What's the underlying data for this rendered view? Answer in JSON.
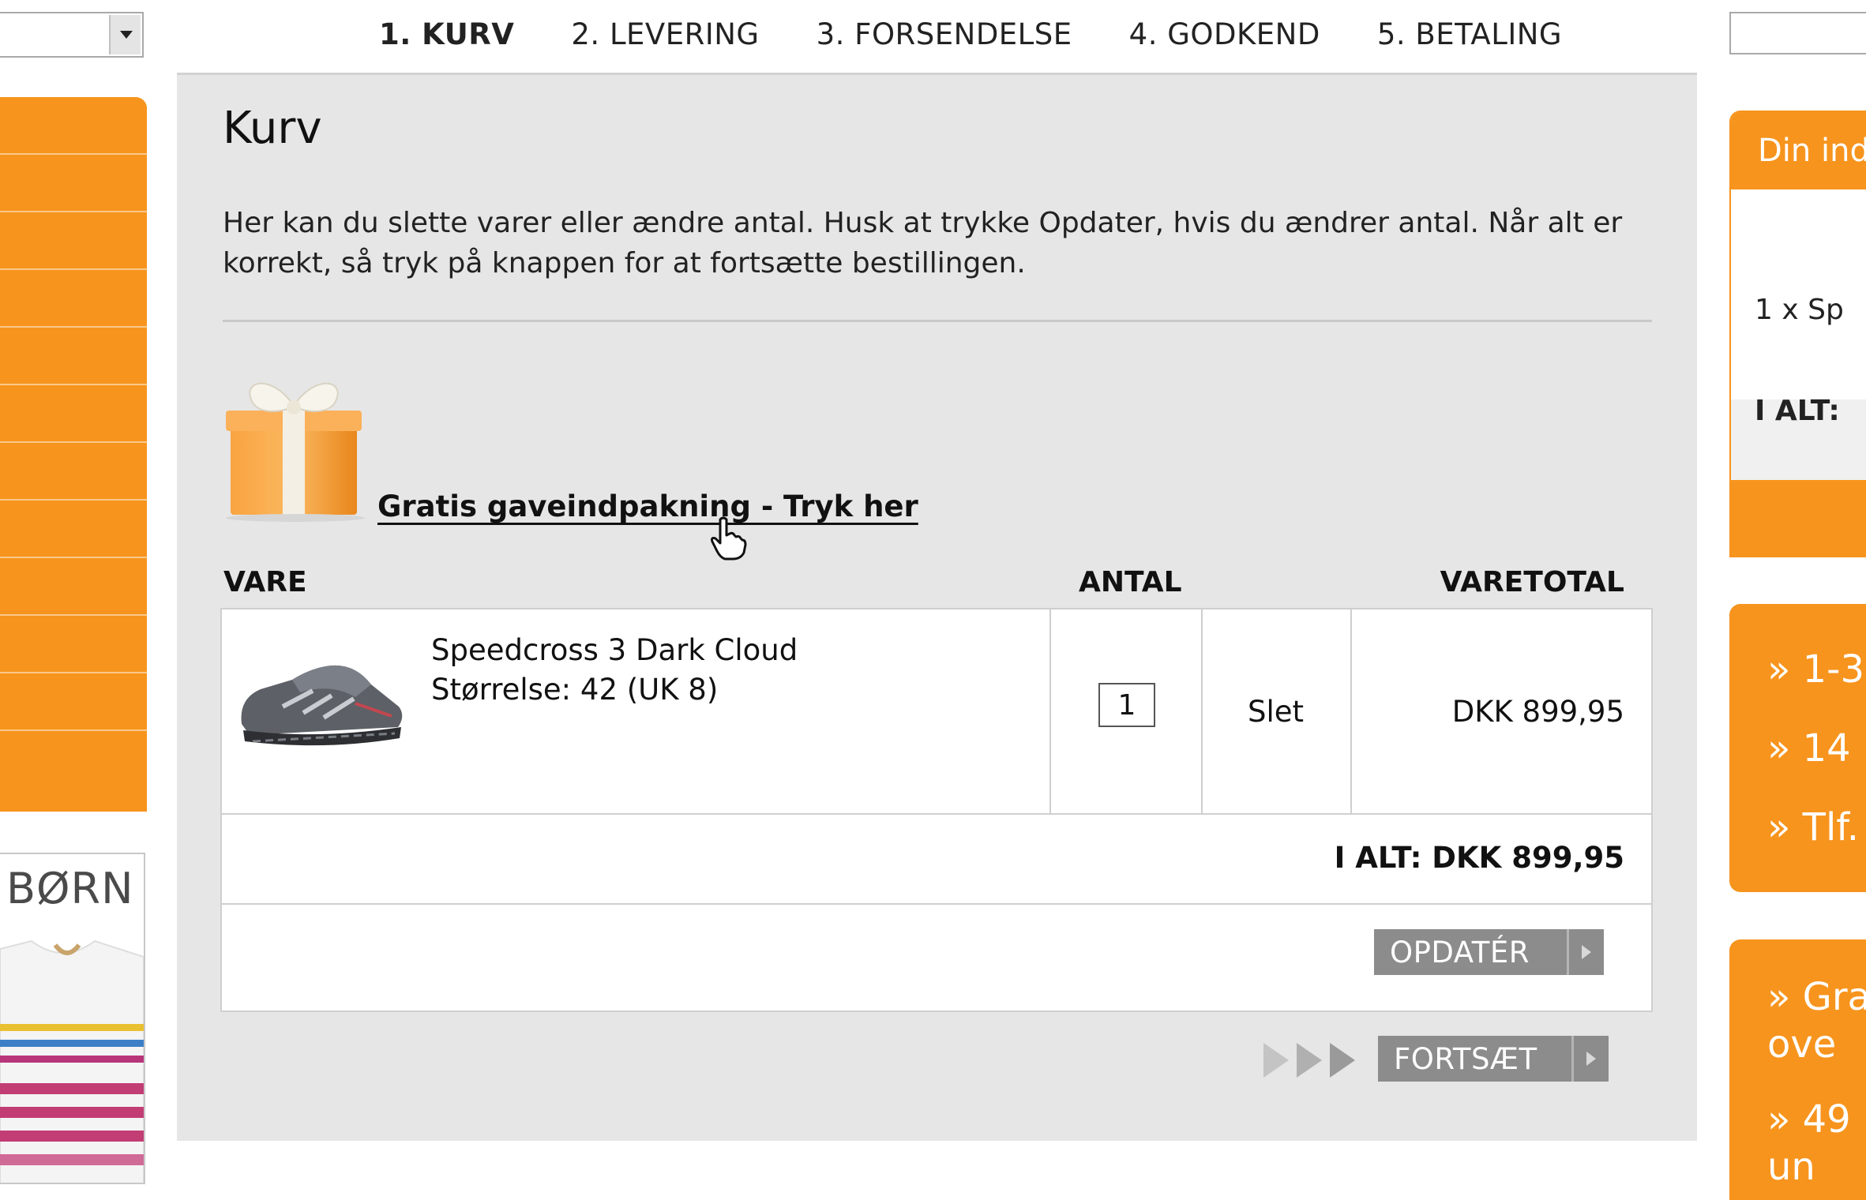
{
  "steps": [
    {
      "label": "1. KURV",
      "active": true
    },
    {
      "label": "2. LEVERING",
      "active": false
    },
    {
      "label": "3. FORSENDELSE",
      "active": false
    },
    {
      "label": "4. GODKEND",
      "active": false
    },
    {
      "label": "5. BETALING",
      "active": false
    }
  ],
  "page": {
    "title": "Kurv",
    "intro": "Her kan du slette varer eller ændre antal. Husk at trykke Opdater, hvis du ændrer antal. Når alt er korrekt, så tryk på knappen for at fortsætte bestillingen."
  },
  "gift": {
    "link_label": "Gratis gaveindpakning - Tryk her"
  },
  "table": {
    "headers": {
      "item": "VARE",
      "qty": "ANTAL",
      "total": "VARETOTAL"
    },
    "rows": [
      {
        "name": "Speedcross 3 Dark Cloud",
        "size": "Størrelse: 42 (UK 8)",
        "qty": "1",
        "delete_label": "Slet",
        "line_total": "DKK 899,95"
      }
    ],
    "grand_total": "I ALT: DKK 899,95",
    "update_label": "OPDATÉR"
  },
  "continue_label": "FORTSÆT",
  "left": {
    "kids_banner_title": "BØRN"
  },
  "right": {
    "basket_title": "Din ind",
    "basket_line": "1 x  Sp",
    "basket_total": "I ALT:",
    "info_box_1": [
      "» 1-3",
      "» 14",
      "» Tlf."
    ],
    "info_box_2": [
      "» Gra",
      "   ove",
      "» 49",
      "   un"
    ]
  },
  "colors": {
    "accent": "#f7941d",
    "panel_bg": "#e6e6e6",
    "button_gray": "#8c8c8c"
  }
}
